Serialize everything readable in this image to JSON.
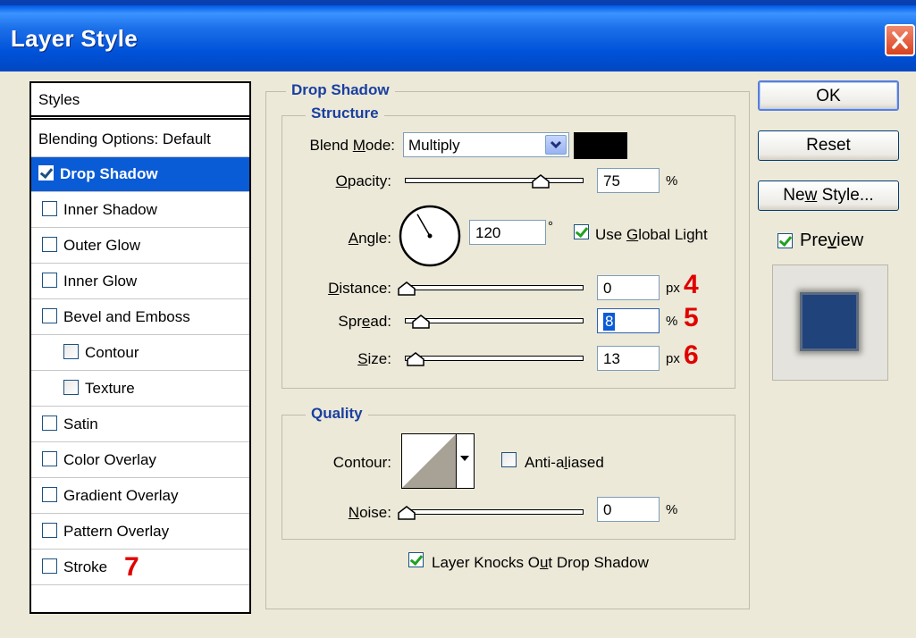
{
  "window": {
    "title": "Layer Style"
  },
  "styles_panel": {
    "header": "Styles",
    "blending_options": "Blending Options: Default",
    "items": [
      {
        "label": "Drop Shadow",
        "checked": true,
        "selected": true
      },
      {
        "label": "Inner Shadow",
        "checked": false
      },
      {
        "label": "Outer Glow",
        "checked": false
      },
      {
        "label": "Inner Glow",
        "checked": false
      },
      {
        "label": "Bevel and Emboss",
        "checked": false
      },
      {
        "label": "Contour",
        "checked": false
      },
      {
        "label": "Texture",
        "checked": false
      },
      {
        "label": "Satin",
        "checked": false
      },
      {
        "label": "Color Overlay",
        "checked": false
      },
      {
        "label": "Gradient Overlay",
        "checked": false
      },
      {
        "label": "Pattern Overlay",
        "checked": false
      },
      {
        "label": "Stroke",
        "checked": false
      }
    ]
  },
  "drop_shadow": {
    "group_title": "Drop Shadow",
    "structure": {
      "group_title": "Structure",
      "blend_mode": {
        "label_pre": "Blend ",
        "label_u": "M",
        "label_post": "ode:",
        "value": "Multiply",
        "color": "#000000"
      },
      "opacity": {
        "label_u": "O",
        "label_post": "pacity:",
        "value": "75",
        "unit": "%",
        "level": 0.75
      },
      "angle": {
        "label_pre": "",
        "label_u": "A",
        "label_post": "ngle:",
        "value": "120",
        "unit": "°",
        "degrees": 120
      },
      "use_global_light": {
        "label_pre": "Use ",
        "label_u": "G",
        "label_post": "lobal Light",
        "checked": true
      },
      "distance": {
        "label_u": "D",
        "label_post": "istance:",
        "value": "0",
        "unit": "px",
        "level": 0.0
      },
      "spread": {
        "label_pre": "Spr",
        "label_u": "e",
        "label_post": "ad:",
        "value": "8",
        "unit": "%",
        "level": 0.08
      },
      "size": {
        "label_u": "S",
        "label_post": "ize:",
        "value": "13",
        "unit": "px",
        "level": 0.05
      }
    },
    "quality": {
      "group_title": "Quality",
      "contour_label": "Contour:",
      "anti_aliased": {
        "label_pre": "Anti-a",
        "label_u": "l",
        "label_post": "iased",
        "checked": false
      },
      "noise": {
        "label_u": "N",
        "label_post": "oise:",
        "value": "0",
        "unit": "%",
        "level": 0.0
      }
    },
    "knockout": {
      "label_pre": "Layer Knocks O",
      "label_u": "u",
      "label_post": "t Drop Shadow",
      "checked": true
    }
  },
  "buttons": {
    "ok": "OK",
    "reset": "Reset",
    "new_style_pre": "Ne",
    "new_style_u": "w",
    "new_style_post": " Style...",
    "preview_pre": "Pre",
    "preview_u": "v",
    "preview_post": "iew",
    "preview_checked": true
  },
  "annotations": {
    "distance_marker": "4",
    "spread_marker": "5",
    "size_marker": "6",
    "stroke_marker": "7"
  },
  "colors": {
    "titlebar": "#0052d9",
    "selection": "#0a5bd6",
    "group_title": "#1a3fa0",
    "marker": "#e00000",
    "preview_fill": "#21437c"
  }
}
